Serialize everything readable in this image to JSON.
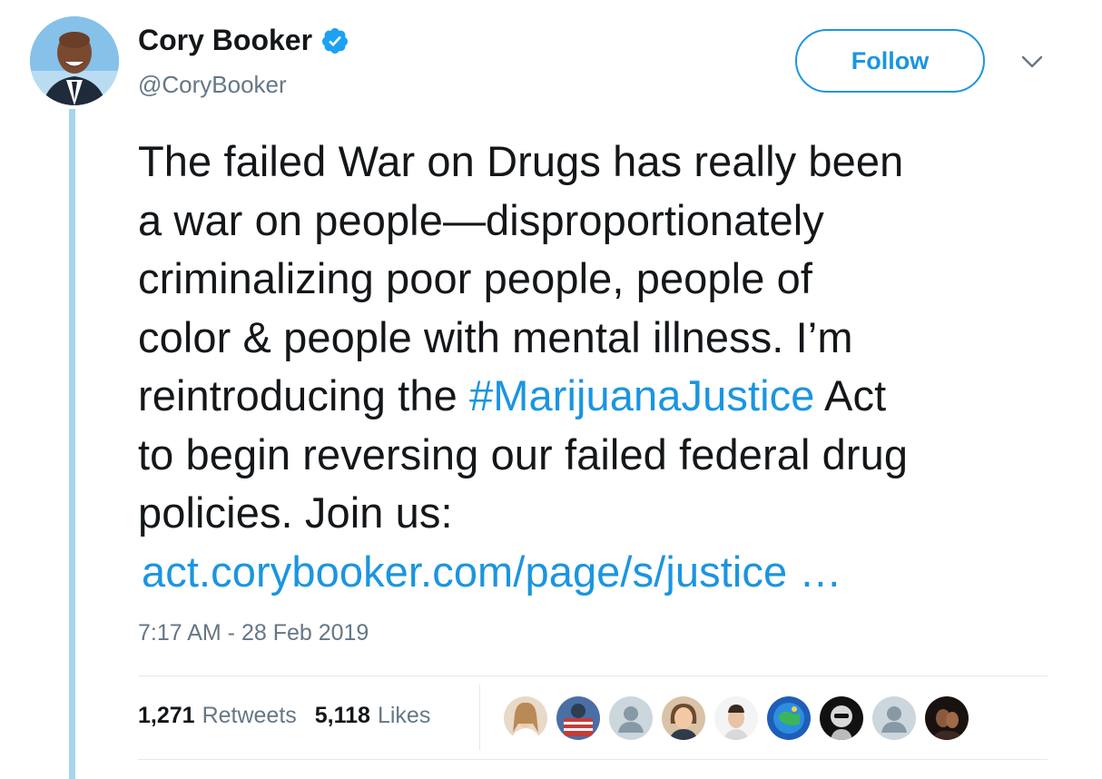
{
  "author": {
    "display_name": "Cory Booker",
    "handle": "@CoryBooker",
    "verified": true,
    "verified_icon": "verified-badge-icon"
  },
  "follow_label": "Follow",
  "menu_icon": "chevron-down-icon",
  "tweet": {
    "lines": [
      "The failed War on Drugs has really been",
      "a war on people—disproportionately",
      "criminalizing poor people, people of",
      "color & people with mental illness. I’m"
    ],
    "line5_before": "reintroducing the ",
    "hashtag": "#MarijuanaJustice",
    "line5_after": " Act",
    "line6": "to begin reversing our failed federal drug",
    "line7": "policies. Join us:",
    "link": "act.corybooker.com/page/s/justice …"
  },
  "timestamp": "7:17 AM - 28 Feb 2019",
  "stats": {
    "retweets_count": "1,271",
    "retweets_label": "Retweets",
    "likes_count": "5,118",
    "likes_label": "Likes"
  },
  "colors": {
    "accent": "#1b95e0",
    "thread_line": "#a9d4ea",
    "secondary_text": "#657786"
  }
}
